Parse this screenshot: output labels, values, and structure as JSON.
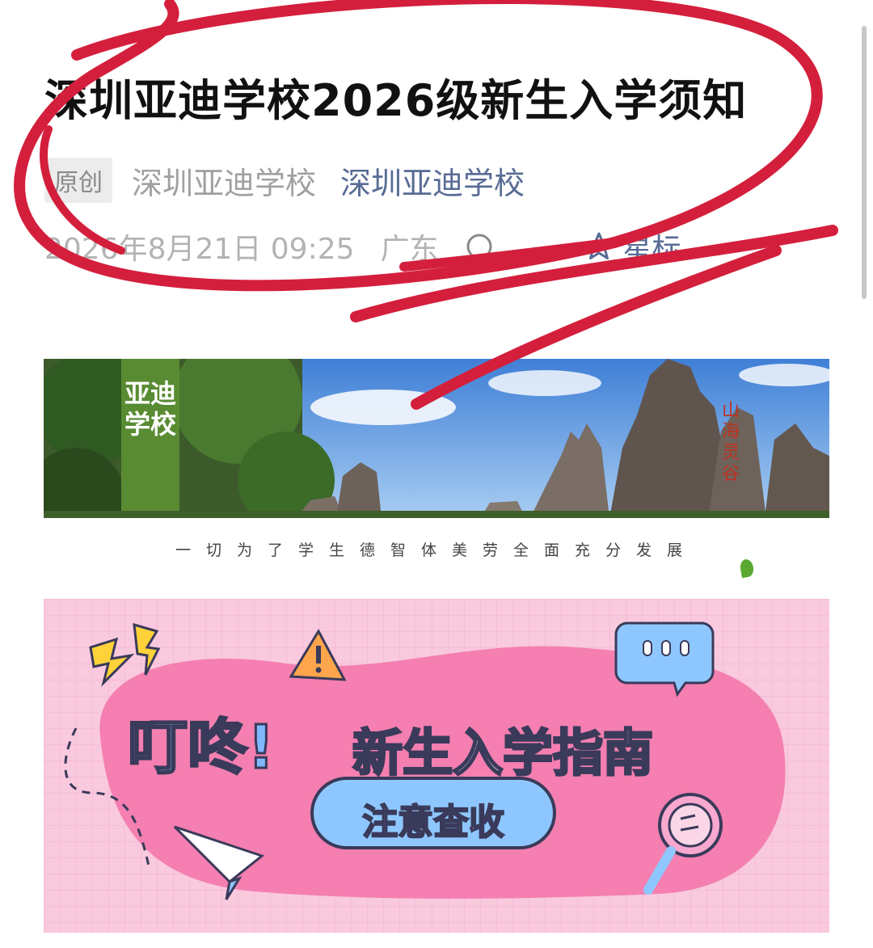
{
  "article": {
    "title": "深圳亚迪学校2026级新生入学须知",
    "original_badge": "原创",
    "author": "深圳亚迪学校",
    "account_name": "深圳亚迪学校",
    "datetime": "2026年8月21日 09:25",
    "location": "广东",
    "star_label": "星标"
  },
  "banner1": {
    "school_name": "亚迪学校",
    "calligraphy": "山海灵谷",
    "motto": "一切为了学生德智体美劳全面充分发展"
  },
  "banner2": {
    "exclaim": "叮咚!",
    "heading": "新生入学指南",
    "button": "注意查收"
  },
  "colors": {
    "link_blue": "#576b95",
    "annotation_red": "#d41f3c",
    "banner_pink": "#f47fb0",
    "banner_bg": "#f9c9de"
  }
}
